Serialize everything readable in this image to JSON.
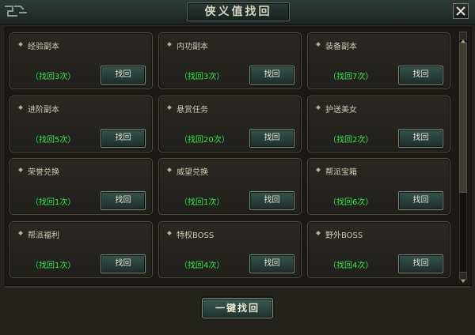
{
  "window": {
    "title": "侠义值找回"
  },
  "cards": [
    {
      "name": "经验副本",
      "count": "（找回3次）",
      "button": "找回"
    },
    {
      "name": "内功副本",
      "count": "（找回3次）",
      "button": "找回"
    },
    {
      "name": "装备副本",
      "count": "（找回7次）",
      "button": "找回"
    },
    {
      "name": "进阶副本",
      "count": "（找回5次）",
      "button": "找回"
    },
    {
      "name": "悬赏任务",
      "count": "（找回20次）",
      "button": "找回"
    },
    {
      "name": "护送美女",
      "count": "（找回2次）",
      "button": "找回"
    },
    {
      "name": "荣誉兑换",
      "count": "（找回1次）",
      "button": "找回"
    },
    {
      "name": "威望兑换",
      "count": "（找回1次）",
      "button": "找回"
    },
    {
      "name": "帮派宝箱",
      "count": "（找回6次）",
      "button": "找回"
    },
    {
      "name": "帮派福利",
      "count": "（找回1次）",
      "button": "找回"
    },
    {
      "name": "特权BOSS",
      "count": "（找回4次）",
      "button": "找回"
    },
    {
      "name": "野外BOSS",
      "count": "（找回4次）",
      "button": "找回"
    }
  ],
  "footer": {
    "recover_all_label": "一键找回"
  },
  "colors": {
    "count_text": "#37e64a",
    "card_border": "#504b3f",
    "button_fill": "#35524d"
  },
  "icons": {
    "close": "close-icon",
    "bullet": "diamond-bullet-icon",
    "ornament": "corner-ornament-icon"
  }
}
